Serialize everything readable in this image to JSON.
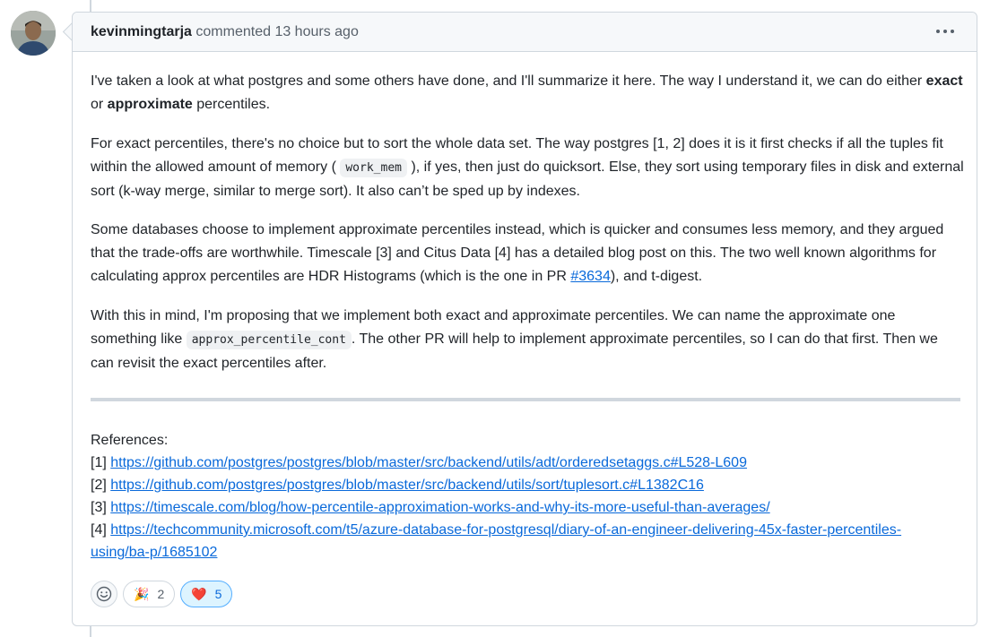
{
  "comment": {
    "author": "kevinmingtarja",
    "action": "commented",
    "time": "13 hours ago",
    "menu_icon": "kebab-horizontal-icon"
  },
  "body": {
    "p1_a": "I've taken a look at what postgres and some others have done, and I'll summarize it here. The way I understand it, we can do either ",
    "p1_b": "exact",
    "p1_c": " or ",
    "p1_d": "approximate",
    "p1_e": " percentiles.",
    "p2_a": "For exact percentiles, there's no choice but to sort the whole data set. The way postgres [1, 2] does it is it first checks if all the tuples fit within the allowed amount of memory (",
    "p2_code": "work_mem",
    "p2_b": "), if yes, then just do quicksort. Else, they sort using temporary files in disk and external sort (k-way merge, similar to merge sort). It also can’t be sped up by indexes.",
    "p3_a": "Some databases choose to implement approximate percentiles instead, which is quicker and consumes less memory, and they argued that the trade-offs are worthwhile. Timescale [3] and Citus Data [4] has a detailed blog post on this. The two well known algorithms for calculating approx percentiles are HDR Histograms (which is the one in PR ",
    "p3_link": "#3634",
    "p3_b": "), and t-digest.",
    "p4_a": "With this in mind, I'm proposing that we implement both exact and approximate percentiles. We can name the approximate one something like ",
    "p4_code": "approx_percentile_cont",
    "p4_b": ". The other PR will help to implement approximate percentiles, so I can do that first. Then we can revisit the exact percentiles after."
  },
  "references": {
    "heading": "References:",
    "items": [
      {
        "num": "[1] ",
        "url": "https://github.com/postgres/postgres/blob/master/src/backend/utils/adt/orderedsetaggs.c#L528-L609"
      },
      {
        "num": "[2] ",
        "url": "https://github.com/postgres/postgres/blob/master/src/backend/utils/sort/tuplesort.c#L1382C16"
      },
      {
        "num": "[3] ",
        "url": "https://timescale.com/blog/how-percentile-approximation-works-and-why-its-more-useful-than-averages/"
      },
      {
        "num": "[4] ",
        "url_line1": "https://techcommunity.microsoft.com/t5/azure-database-for-postgresql/diary-of-an-engineer-delivering-45x-faster-percentiles-",
        "url_line2": "using/ba-p/1685102"
      }
    ]
  },
  "reactions": {
    "add_icon": "smiley-icon",
    "tada_emoji": "🎉",
    "tada_count": "2",
    "heart_emoji": "❤️",
    "heart_count": "5"
  },
  "colors": {
    "link": "#0969da",
    "border": "#d0d7de",
    "header_bg": "#f6f8fa",
    "active_reaction_bg": "#ddf4ff"
  }
}
